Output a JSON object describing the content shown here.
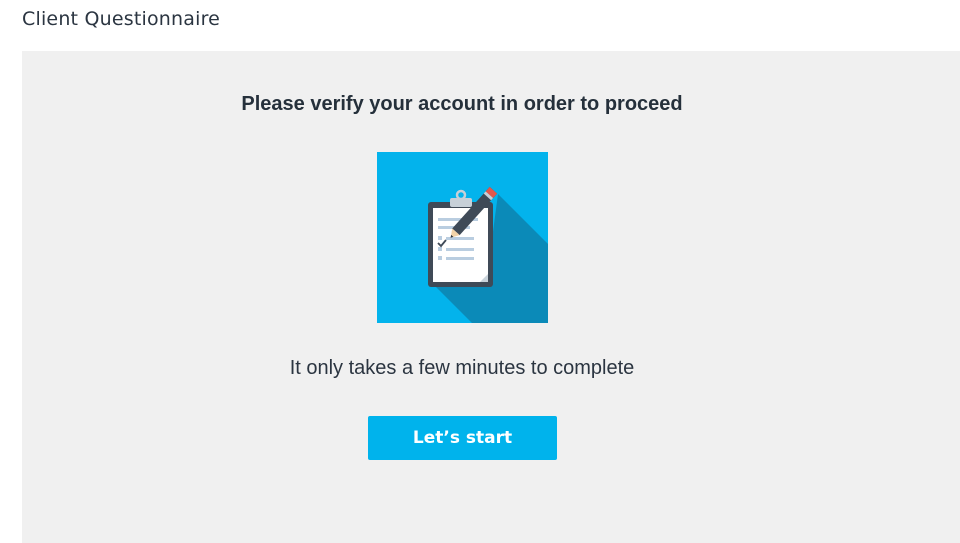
{
  "page": {
    "title": "Client Questionnaire"
  },
  "verify": {
    "heading": "Please verify your account in order to proceed",
    "illustration_icon": "clipboard-pencil-icon",
    "subtext": "It only takes a few minutes to complete",
    "start_label": "Let’s start"
  },
  "colors": {
    "accent": "#00b3ec",
    "illustration_bg": "#00b3ec",
    "panel_bg": "#f0f0f0"
  }
}
